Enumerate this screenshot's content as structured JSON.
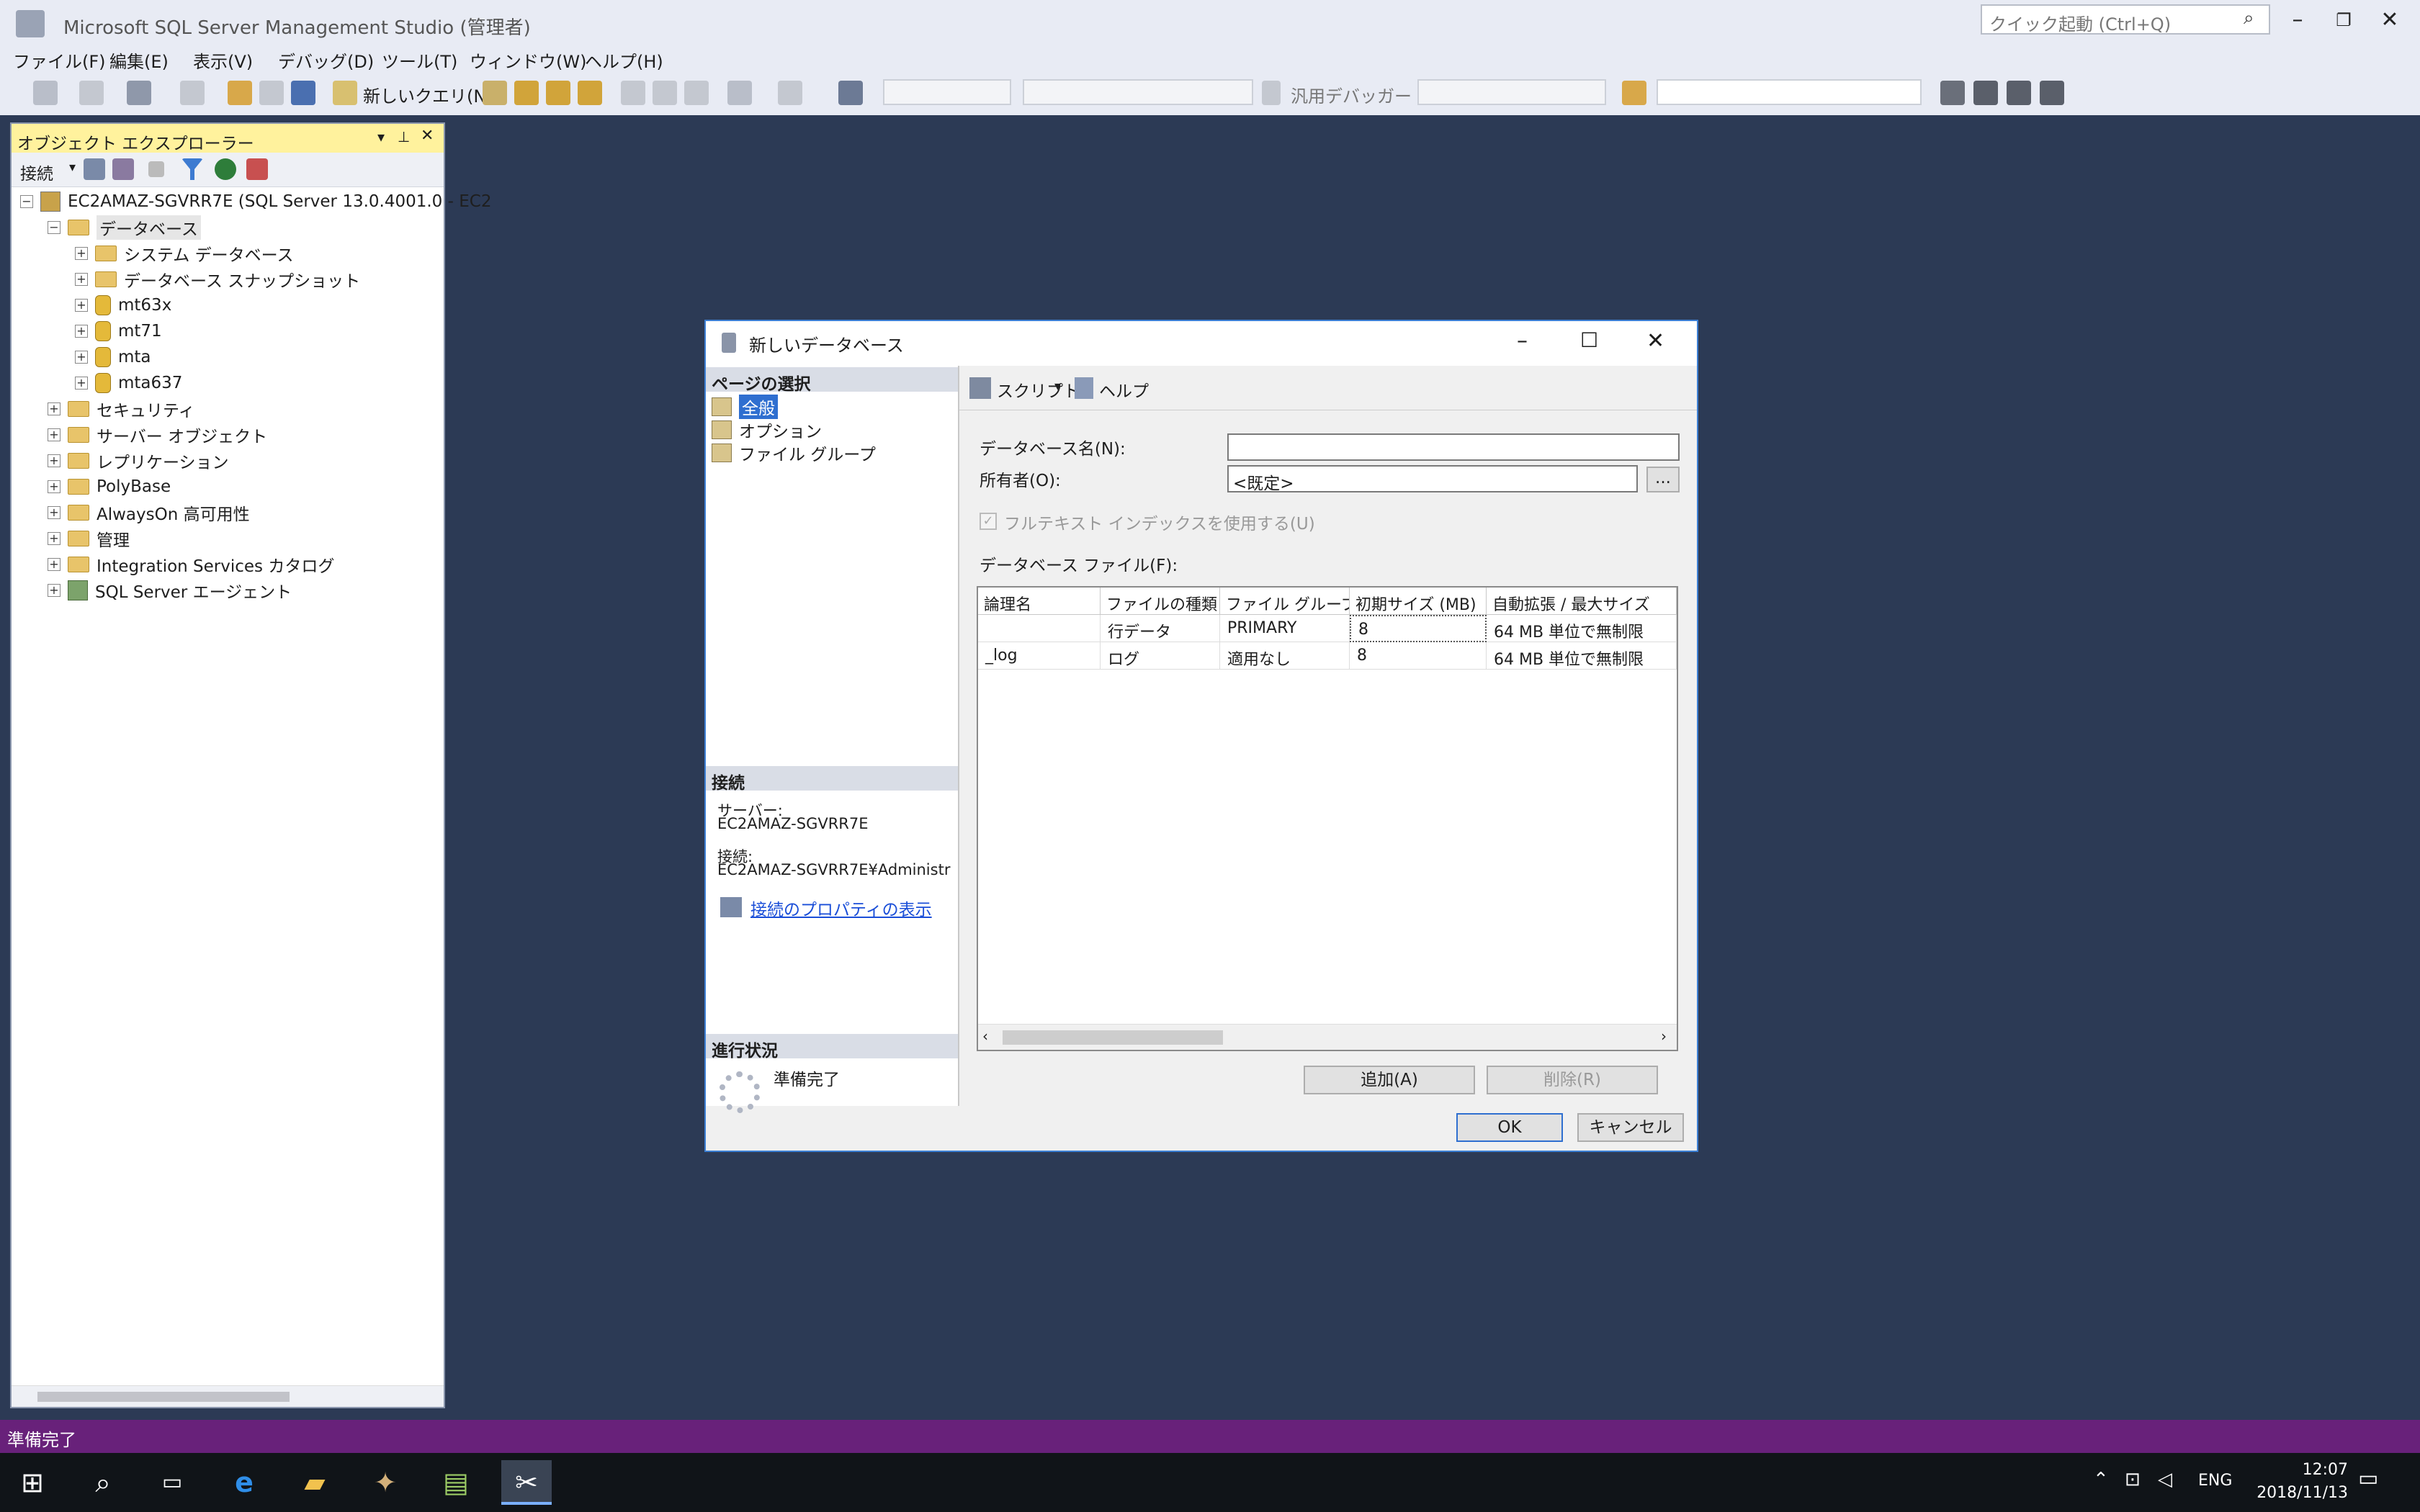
{
  "app": {
    "title": "Microsoft SQL Server Management Studio (管理者)",
    "quick_launch_placeholder": "クイック起動 (Ctrl+Q)"
  },
  "menu": [
    "ファイル(F)",
    "編集(E)",
    "表示(V)",
    "デバッグ(D)",
    "ツール(T)",
    "ウィンドウ(W)",
    "ヘルプ(H)"
  ],
  "toolbar": {
    "new_query": "新しいクエリ(N)",
    "debugger_label": "汎用デバッガー"
  },
  "object_explorer": {
    "title": "オブジェクト エクスプローラー",
    "connect_label": "接続",
    "server_node": "EC2AMAZ-SGVRR7E (SQL Server 13.0.4001.0 - EC2",
    "nodes": {
      "databases": "データベース",
      "system_db": "システム データベース",
      "snapshot": "データベース スナップショット",
      "db1": "mt63x",
      "db2": "mt71",
      "db3": "mta",
      "db4": "mta637",
      "security": "セキュリティ",
      "server_objects": "サーバー オブジェクト",
      "replication": "レプリケーション",
      "polybase": "PolyBase",
      "alwayson": "AlwaysOn 高可用性",
      "management": "管理",
      "integration": "Integration Services カタログ",
      "agent": "SQL Server エージェント"
    }
  },
  "status_bar": {
    "text": "準備完了",
    "color": "#68217a"
  },
  "taskbar": {
    "lang": "ENG",
    "time": "12:07",
    "date": "2018/11/13"
  },
  "dialog": {
    "title": "新しいデータベース",
    "page_select_header": "ページの選択",
    "pages": [
      "全般",
      "オプション",
      "ファイル グループ"
    ],
    "connection_header": "接続",
    "server_label": "サーバー:",
    "server_value": "EC2AMAZ-SGVRR7E",
    "connection_label": "接続:",
    "connection_value": "EC2AMAZ-SGVRR7E¥Administr",
    "view_props_link": "接続のプロパティの表示",
    "progress_header": "進行状況",
    "progress_status": "準備完了",
    "script_button": "スクリプト",
    "help_button": "ヘルプ",
    "db_name_label": "データベース名(N):",
    "db_name_value": "",
    "owner_label": "所有者(O):",
    "owner_value": "<既定>",
    "owner_browse": "...",
    "fulltext_label": "フルテキスト インデックスを使用する(U)",
    "files_label": "データベース ファイル(F):",
    "columns": [
      "論理名",
      "ファイルの種類",
      "ファイル グループ",
      "初期サイズ (MB)",
      "自動拡張 / 最大サイズ"
    ],
    "rows": [
      [
        "",
        "行データ",
        "PRIMARY",
        "8",
        "64 MB 単位で無制限"
      ],
      [
        "_log",
        "ログ",
        "適用なし",
        "8",
        "64 MB 単位で無制限"
      ]
    ],
    "add_button": "追加(A)",
    "remove_button": "削除(R)",
    "ok_button": "OK",
    "cancel_button": "キャンセル"
  }
}
